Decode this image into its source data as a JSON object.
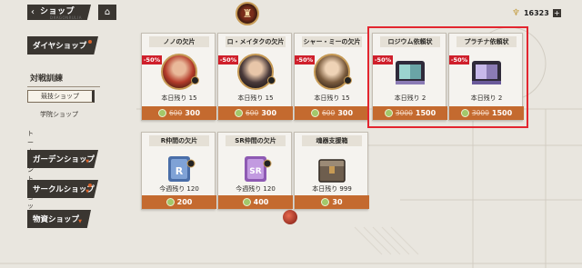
{
  "header": {
    "back_label": "ショップ",
    "back_sub": "DRAGONRULIA",
    "home_icon": "home-icon",
    "currency": {
      "amount": "16323",
      "plus": "+"
    }
  },
  "sidebar": {
    "tabs": [
      {
        "label": "ダイヤショップ"
      },
      {
        "label": "ガーデンショップ"
      },
      {
        "label": "サークルショップ"
      },
      {
        "label": "物資ショップ"
      }
    ],
    "group": {
      "label": "対戦訓練",
      "subs": [
        {
          "label": "競技ショップ",
          "active": true
        },
        {
          "label": "学院ショップ",
          "active": false
        }
      ],
      "extra": "トーナメントショップ"
    }
  },
  "cards": [
    {
      "title": "ノノの欠片",
      "discount": "-50%",
      "stock": "本日残り 15",
      "old_price": "600",
      "price": "300",
      "color": "#b43b2a"
    },
    {
      "title": "ロ・メイタクの欠片",
      "discount": "-50%",
      "stock": "本日残り 15",
      "old_price": "600",
      "price": "300",
      "color": "#4a3a3a"
    },
    {
      "title": "シャー・ミーの欠片",
      "discount": "-50%",
      "stock": "本日残り 15",
      "old_price": "600",
      "price": "300",
      "color": "#7b5c3e"
    },
    {
      "title": "ロジウム依頼状",
      "discount": "-50%",
      "stock": "本日残り 2",
      "old_price": "3000",
      "price": "1500",
      "color": "#6aa4a6"
    },
    {
      "title": "プラチナ依頼状",
      "discount": "-50%",
      "stock": "本日残り 2",
      "old_price": "3000",
      "price": "1500",
      "color": "#8b7bb5"
    },
    {
      "title": "R仲間の欠片",
      "stock": "今週残り 120",
      "price": "200",
      "color": "#4a6ea8",
      "letter": "R"
    },
    {
      "title": "SR仲間の欠片",
      "stock": "今週残り 120",
      "price": "400",
      "color": "#8e5ab3",
      "letter": "SR"
    },
    {
      "title": "魂器支援箱",
      "stock": "本日残り 999",
      "price": "30",
      "color": "#6e5e4e"
    }
  ]
}
